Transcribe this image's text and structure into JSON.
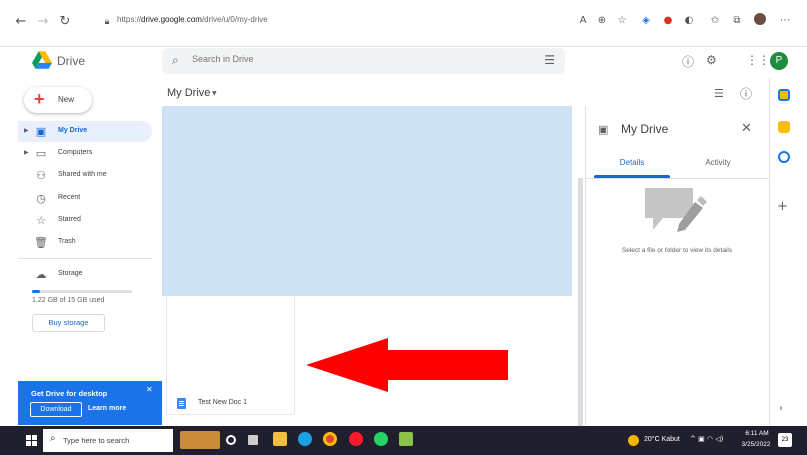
{
  "browser": {
    "url_prefix": "https://",
    "url_host": "drive.google.com",
    "url_path": "/drive/u/0/my-drive"
  },
  "header": {
    "app_name": "Drive",
    "search_placeholder": "Search in Drive",
    "avatar_initial": "P"
  },
  "sidebar": {
    "new_label": "New",
    "items": [
      {
        "label": "My Drive",
        "icon": "drive-icon",
        "active": true
      },
      {
        "label": "Computers",
        "icon": "computer-icon",
        "active": false
      },
      {
        "label": "Shared with me",
        "icon": "people-icon",
        "active": false
      },
      {
        "label": "Recent",
        "icon": "clock-icon",
        "active": false
      },
      {
        "label": "Starred",
        "icon": "star-icon",
        "active": false
      },
      {
        "label": "Trash",
        "icon": "trash-icon",
        "active": false
      }
    ],
    "storage_label": "Storage",
    "storage_used_text": "1.22 GB of 15 GB used",
    "storage_used_fraction": 0.08,
    "buy_storage_label": "Buy storage"
  },
  "main": {
    "breadcrumb": "My Drive",
    "files": [
      {
        "name": "Test New Doc 1",
        "type": "google-doc"
      }
    ]
  },
  "details_panel": {
    "title": "My Drive",
    "tabs": [
      {
        "label": "Details",
        "active": true
      },
      {
        "label": "Activity",
        "active": false
      }
    ],
    "empty_message": "Select a file or folder to view its details"
  },
  "promo": {
    "title": "Get Drive for desktop",
    "download_label": "Download",
    "learn_more_label": "Learn more"
  },
  "taskbar": {
    "search_placeholder": "Type here to search",
    "weather": "20°C  Kabut",
    "time": "6:11 AM",
    "date": "3/25/2022",
    "notification_count": "23"
  },
  "colors": {
    "accent_blue": "#1a73e8",
    "selection": "#cfe2f3",
    "annotation_arrow": "#ff0000"
  }
}
